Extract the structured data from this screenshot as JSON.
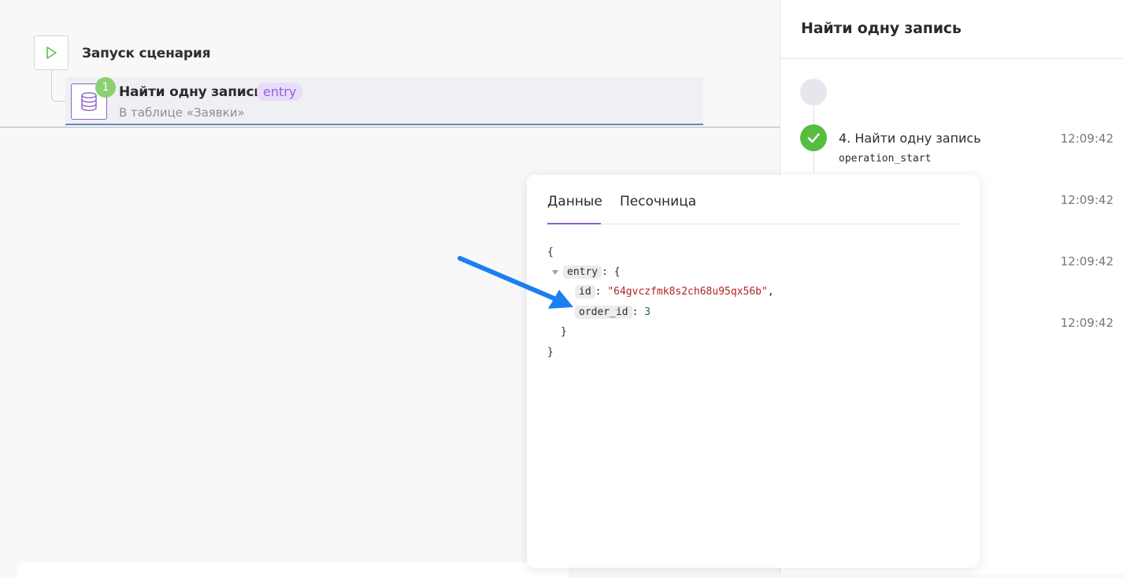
{
  "scenario": {
    "start_label": "Запуск сценария",
    "step": {
      "badge": "1",
      "title": "Найти одну запись",
      "tag": "entry",
      "subtitle": "В таблице «Заявки»"
    }
  },
  "right_panel": {
    "title": "Найти одну запись",
    "events": [
      {
        "title": "4. Найти одну запись",
        "code": "operation_start",
        "time": "12:09:42"
      },
      {
        "time": "12:09:42"
      },
      {
        "time": "12:09:42"
      },
      {
        "time": "12:09:42"
      }
    ]
  },
  "popup": {
    "tabs": [
      "Данные",
      "Песочница"
    ],
    "active_tab": "Данные",
    "json": {
      "open_brace": "{",
      "entry_key": "entry",
      "entry_open": ": {",
      "id_key": "id",
      "id_value": "\"64gvczfmk8s2ch68u95qx56b\"",
      "order_id_key": "order_id",
      "order_id_value": "3",
      "inner_close": "}",
      "outer_close": "}"
    }
  },
  "colors": {
    "accent_purple": "#8a62c9",
    "success_green": "#56bd3e",
    "annotation_blue": "#1a7ff0"
  },
  "icons": [
    "play-icon",
    "database-icon",
    "checkmark-icon",
    "arrow-annotation-icon"
  ]
}
